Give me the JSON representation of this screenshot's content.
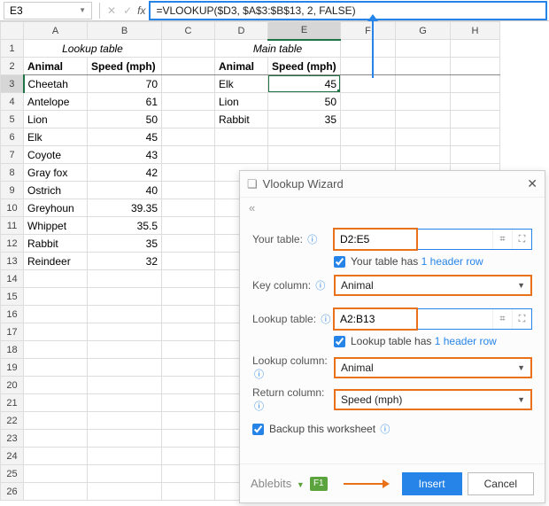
{
  "namebox": "E3",
  "formula": "=VLOOKUP($D3, $A$3:$B$13, 2, FALSE)",
  "cols": [
    "A",
    "B",
    "C",
    "D",
    "E",
    "F",
    "G",
    "H"
  ],
  "lookup_title": "Lookup table",
  "main_title": "Main table",
  "lh": {
    "a": "Animal",
    "b": "Speed (mph)"
  },
  "mh": {
    "d": "Animal",
    "e": "Speed (mph)"
  },
  "lookup": [
    {
      "a": "Cheetah",
      "b": "70"
    },
    {
      "a": "Antelope",
      "b": "61"
    },
    {
      "a": "Lion",
      "b": "50"
    },
    {
      "a": "Elk",
      "b": "45"
    },
    {
      "a": "Coyote",
      "b": "43"
    },
    {
      "a": "Gray fox",
      "b": "42"
    },
    {
      "a": "Ostrich",
      "b": "40"
    },
    {
      "a": "Greyhoun",
      "b": "39.35"
    },
    {
      "a": "Whippet",
      "b": "35.5"
    },
    {
      "a": "Rabbit",
      "b": "35"
    },
    {
      "a": "Reindeer",
      "b": "32"
    }
  ],
  "main": [
    {
      "d": "Elk",
      "e": "45"
    },
    {
      "d": "Lion",
      "e": "50"
    },
    {
      "d": "Rabbit",
      "e": "35"
    }
  ],
  "wizard": {
    "title": "Vlookup Wizard",
    "your_table_label": "Your table:",
    "your_table": "D2:E5",
    "your_table_hdr_pre": "Your table has",
    "your_table_hdr_link": "1 header row",
    "key_col_label": "Key column:",
    "key_col": "Animal",
    "lookup_table_label": "Lookup table:",
    "lookup_table": "A2:B13",
    "lookup_table_hdr_pre": "Lookup table has",
    "lookup_table_hdr_link": "1 header row",
    "lookup_col_label": "Lookup column:",
    "lookup_col": "Animal",
    "return_col_label": "Return column:",
    "return_col": "Speed (mph)",
    "backup": "Backup this worksheet",
    "brand": "Ablebits",
    "f1": "F1",
    "insert": "Insert",
    "cancel": "Cancel"
  }
}
